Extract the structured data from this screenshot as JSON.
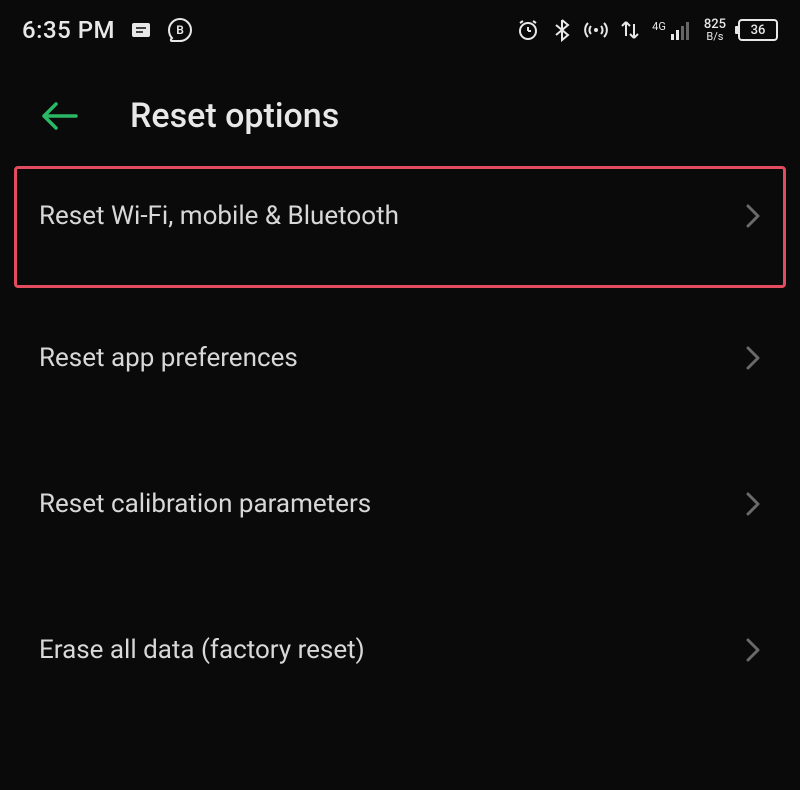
{
  "status_bar": {
    "time": "6:35 PM",
    "network_speed": "825",
    "network_unit": "B/s",
    "battery_level": "36",
    "signal_label": "4G"
  },
  "header": {
    "title": "Reset options"
  },
  "options": [
    {
      "label": "Reset Wi-Fi, mobile & Bluetooth",
      "highlighted": true
    },
    {
      "label": "Reset app preferences",
      "highlighted": false
    },
    {
      "label": "Reset calibration parameters",
      "highlighted": false
    },
    {
      "label": "Erase all data (factory reset)",
      "highlighted": false
    }
  ],
  "colors": {
    "accent": "#2bb865",
    "highlight_border": "#e34b5f"
  }
}
